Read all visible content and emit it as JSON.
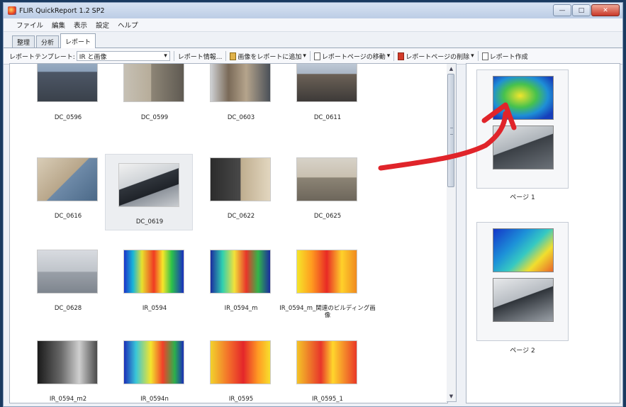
{
  "window": {
    "title": "FLIR QuickReport 1.2 SP2",
    "min": "—",
    "max": "□",
    "close": "✕"
  },
  "menu": [
    "ファイル",
    "編集",
    "表示",
    "設定",
    "ヘルプ"
  ],
  "tabs": [
    "整理",
    "分析",
    "レポート"
  ],
  "toolbar": {
    "template_label": "レポートテンプレート:",
    "template_value": "IR と画像",
    "report_info": "レポート情報...",
    "add_image": "画像をレポートに追加",
    "move_page": "レポートページの移動",
    "delete_page": "レポートページの削除",
    "create_report": "レポート作成"
  },
  "thumbnails": [
    {
      "label": "DC_0596",
      "image": "building-photo"
    },
    {
      "label": "DC_0599",
      "image": "building-photo"
    },
    {
      "label": "DC_0603",
      "image": "building-photo"
    },
    {
      "label": "DC_0611",
      "image": "building-photo"
    },
    {
      "label": "DC_0616",
      "image": "wall-photo"
    },
    {
      "label": "DC_0619",
      "image": "laptop-photo",
      "selected": true
    },
    {
      "label": "DC_0622",
      "image": "laptop-photo"
    },
    {
      "label": "DC_0625",
      "image": "box-photo"
    },
    {
      "label": "DC_0628",
      "image": "desk-photo"
    },
    {
      "label": "IR_0594",
      "image": "ir-image"
    },
    {
      "label": "IR_0594_m",
      "image": "ir-image"
    },
    {
      "label": "IR_0594_m_関連のビルディング画像",
      "image": "ir-image"
    },
    {
      "label": "IR_0594_m2",
      "image": "grayscale-image"
    },
    {
      "label": "IR_0594n",
      "image": "ir-image"
    },
    {
      "label": "IR_0595",
      "image": "ir-image"
    },
    {
      "label": "IR_0595_1",
      "image": "ir-image"
    }
  ],
  "pages": [
    {
      "label": "ページ 1"
    },
    {
      "label": "ページ 2"
    }
  ],
  "colors": {
    "arrow": "#e0242a",
    "selection": "#eceef1"
  }
}
